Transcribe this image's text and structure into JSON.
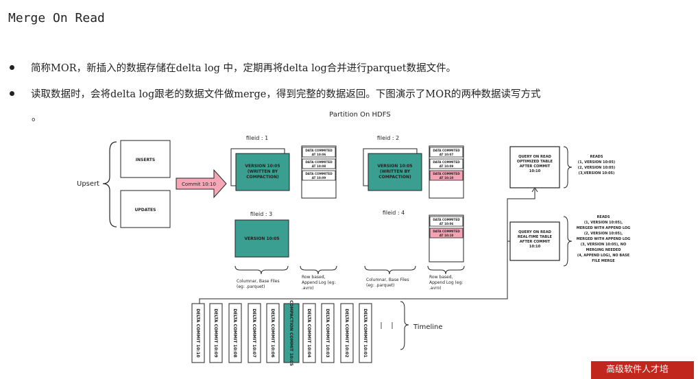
{
  "title": "Merge On Read",
  "bullets": [
    "简称MOR，新插入的数据存储在delta log 中，定期再将delta log合并进行parquet数据文件。",
    "读取数据时，会将delta log跟老的数据文件做merge，得到完整的数据返回。下图演示了MOR的两种数据读写方式"
  ],
  "bullet2_cont": "。",
  "diagram": {
    "header": "Partition On HDFS",
    "upsert": "Upsert",
    "inserts": "INSERTS",
    "updates": "UPDATES",
    "commit": "Commit 10:10",
    "fileids": [
      "fileid : 1",
      "fileid : 2",
      "fileid : 3",
      "fileid : 4"
    ],
    "version_compaction": [
      "VERSION 10:05",
      "(WRITTEN BY",
      "COMPACTION)"
    ],
    "version_plain": "VERSION 10:05",
    "log1": [
      "DATA COMMITED",
      "AT 10:06",
      "DATA COMMITED",
      "AT 10:08",
      "DATA COMMITED",
      "AT 10:09"
    ],
    "log2": [
      "DATA COMMITED",
      "AT 10:07",
      "DATA COMMITED",
      "AT 10:09",
      "DATA COMMITED",
      "AT 10:10"
    ],
    "log4": [
      "DATA COMMITED",
      "AT 10:06",
      "DATA COMMITED",
      "AT 10:10"
    ],
    "columnar": [
      "Columnar, Base Files",
      "(eg: .parquet)"
    ],
    "rowbased": [
      "Row based,",
      "Append Log (eg:",
      ".avro)"
    ],
    "query_ro": [
      "QUERY ON READ",
      "OPTIMIZED TABLE",
      "AFTER COMMIT",
      "10:10"
    ],
    "query_rt": [
      "QUERY ON READ",
      "REAL-TIME TABLE",
      "AFTER COMMIT",
      "10:10"
    ],
    "reads_ro": [
      "READS",
      "(1, VERSION 10:05)",
      "(2, VERSION 10:05)",
      "(3,VERSION 10:05)"
    ],
    "reads_rt": [
      "READS",
      "(1, VERSION 10:05),",
      "MERGED WITH APPEND LOG",
      "(2, VERSION 10:05),",
      "MERGED WITH APPEND LOG",
      "(3, VERSION 10:05), NO",
      "MERGING NEEDED",
      "(4, APPEND LOG), NO BASE",
      "FILE MERGE"
    ],
    "timeline_label": "Timeline",
    "timeline": [
      "DELTA COMMIT 10:10",
      "DELTA COMMIT 10:09",
      "DELTA COMMIT 10:08",
      "DELTA COMMIT 10:07",
      "DELTA COMMIT 10:06",
      "COMPACTION COMMIT 10:05",
      "DELTA COMMIT 10:04",
      "DELTA COMMIT 10:03",
      "DELTA COMMIT 10:02",
      "DELTA COMMIT 10:01"
    ],
    "colors": {
      "teal": "#3a9e90",
      "pink": "#f5a3b4",
      "arrow": "#f6a7b7"
    }
  },
  "watermark": "高级软件人才培"
}
